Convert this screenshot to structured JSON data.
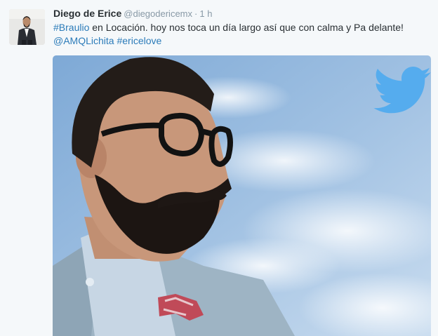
{
  "tweet": {
    "fullname": "Diego de Erice",
    "username": "@diegodericemx",
    "separator": "·",
    "time": "1 h",
    "text": {
      "hashtag1": "#Braulio",
      "body": " en Locación. hoy nos toca un día largo así que con calma y Pa delante!",
      "mention": "@AMQLichita",
      "hashtag2": "#ericelove"
    }
  },
  "icons": {
    "twitter_bird": "twitter-bird-icon",
    "bird_color": "#55acee"
  },
  "colors": {
    "link": "#2b7bb9",
    "name": "#292f33",
    "meta": "#8899a6",
    "background": "#f5f8fa"
  }
}
